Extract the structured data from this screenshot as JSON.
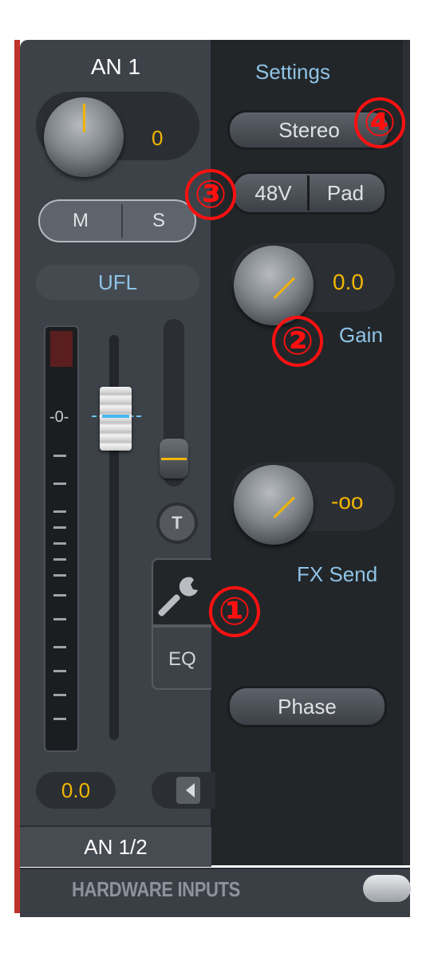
{
  "channel": {
    "name": "AN 1",
    "pan_value": "0",
    "mute_label": "M",
    "solo_label": "S",
    "routing": "UFL",
    "meter_zero_label": "-0-",
    "volume_value": "0.0",
    "talkback_label": "T",
    "eq_tab_label": "EQ",
    "footer_label": "AN 1/2"
  },
  "settings": {
    "title": "Settings",
    "stereo_label": "Stereo",
    "phantom_label": "48V",
    "pad_label": "Pad",
    "gain_value": "0.0",
    "gain_label": "Gain",
    "fx_send_value": "-oo",
    "fx_send_label": "FX Send",
    "phase_label": "Phase"
  },
  "section": {
    "label": "HARDWARE INPUTS"
  },
  "callouts": {
    "c1": "①",
    "c2": "②",
    "c3": "③",
    "c4": "④"
  },
  "colors": {
    "value_accent": "#f2b600",
    "label_accent": "#8fc3e6",
    "callout": "#ff1010",
    "channel_marker": "#c0312a"
  },
  "icons": {
    "settings_tab": "wrench-icon",
    "volume_arrow": "triangle-left-icon"
  }
}
